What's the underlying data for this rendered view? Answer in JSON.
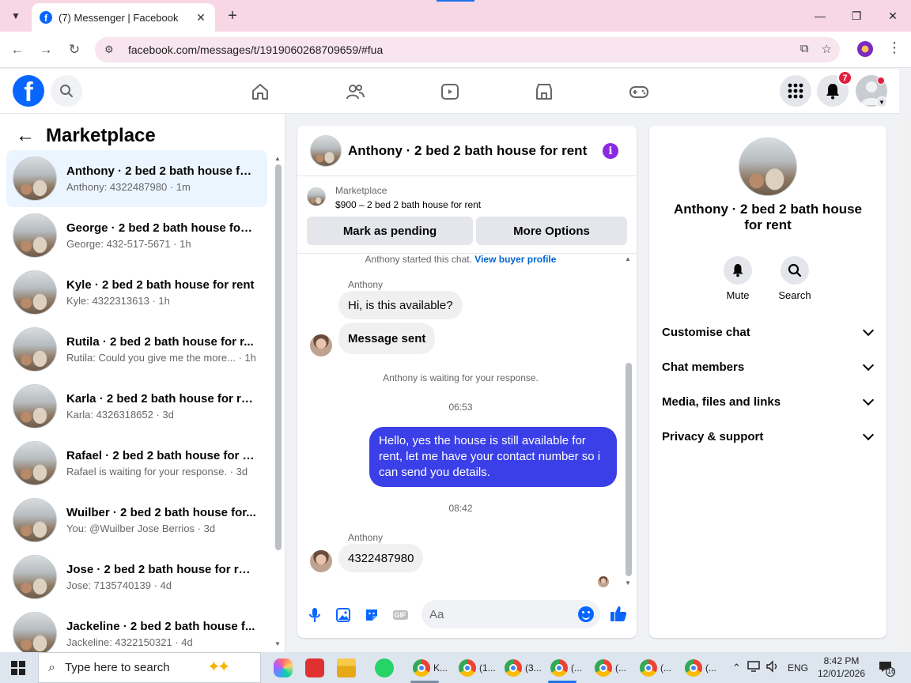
{
  "browser": {
    "tab_title": "(7) Messenger | Facebook",
    "new_tab": "+",
    "url": "facebook.com/messages/t/1919060268709659/#fua"
  },
  "header": {
    "notification_count": "7"
  },
  "sidebar": {
    "title": "Marketplace",
    "conversations": [
      {
        "name": "Anthony · 2 bed 2 bath house fo...",
        "preview": "Anthony: 4322487980 · 1m"
      },
      {
        "name": "George · 2 bed 2 bath house for ...",
        "preview": "George: 432-517-5671 · 1h"
      },
      {
        "name": "Kyle · 2 bed 2 bath house for rent",
        "preview": "Kyle: 4322313613 · 1h"
      },
      {
        "name": "Rutila · 2 bed 2 bath house for r...",
        "preview": "Rutila: Could you give me the more... · 1h"
      },
      {
        "name": "Karla · 2 bed 2 bath house for rent",
        "preview": "Karla: 4326318652 · 3d"
      },
      {
        "name": "Rafael · 2 bed 2 bath house for r...",
        "preview": "Rafael is waiting for your response. · 3d"
      },
      {
        "name": "Wuilber · 2 bed 2 bath house for...",
        "preview": "You: @Wuilber Jose Berrios · 3d"
      },
      {
        "name": "Jose · 2 bed 2 bath house for rent",
        "preview": "Jose: 7135740139 · 4d"
      },
      {
        "name": "Jackeline · 2 bed 2 bath house f...",
        "preview": "Jackeline: 4322150321 · 4d"
      }
    ]
  },
  "chat": {
    "title": "Anthony · 2 bed 2 bath house for rent",
    "marketplace_label": "Marketplace",
    "listing": "$900 – 2 bed 2 bath house for rent",
    "mark_pending": "Mark as pending",
    "more_options": "More Options",
    "started": "Anthony started this chat.",
    "view_profile": "View buyer profile",
    "sender_name": "Anthony",
    "msg1": "Hi, is this available?",
    "msg2": "Message sent",
    "waiting": "Anthony is waiting for your response.",
    "time1": "06:53",
    "outgoing": "Hello, yes the house is still available for rent, let me have your contact number so i can send you details.",
    "time2": "08:42",
    "sender_name2": "Anthony",
    "msg3": "4322487980",
    "input_placeholder": "Aa",
    "gif_label": "GIF"
  },
  "info": {
    "title": "Anthony · 2 bed 2 bath house for rent",
    "mute": "Mute",
    "search": "Search",
    "sections": [
      "Customise chat",
      "Chat members",
      "Media, files and links",
      "Privacy & support"
    ]
  },
  "taskbar": {
    "search_placeholder": "Type here to search",
    "chrome_windows": [
      "K...",
      "(1...",
      "(3...",
      "(...",
      "(...",
      "(...",
      "(..."
    ],
    "language": "ENG",
    "time": "8:42 PM",
    "date": "12/01/2026",
    "notification_count": "16"
  }
}
